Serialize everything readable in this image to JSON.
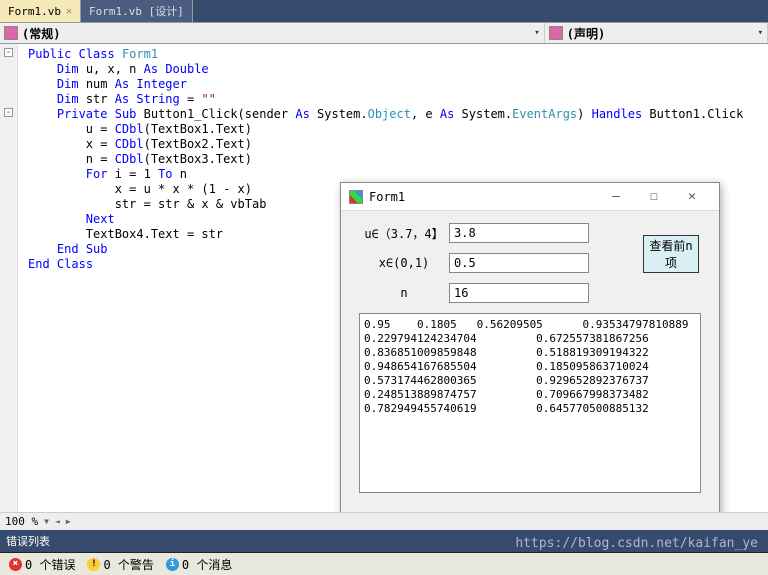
{
  "tabs": {
    "active": "Form1.vb",
    "inactive": "Form1.vb [设计]"
  },
  "dropdowns": {
    "left": "(常规)",
    "right": "(声明)"
  },
  "code": {
    "l1a": "Public",
    "l1b": "Class",
    "l1c": "Form1",
    "l2a": "Dim",
    "l2b": " u, x, n ",
    "l2c": "As",
    "l2d": "Double",
    "l3a": "Dim",
    "l3b": " num ",
    "l3c": "As",
    "l3d": "Integer",
    "l4a": "Dim",
    "l4b": " str ",
    "l4c": "As",
    "l4d": "String",
    "l4e": " = ",
    "l4f": "\"\"",
    "l5a": "Private",
    "l5b": "Sub",
    "l5c": " Button1_Click(sender ",
    "l5d": "As",
    "l5e": " System.",
    "l5f": "Object",
    "l5g": ", e ",
    "l5h": "As",
    "l5i": " System.",
    "l5j": "EventArgs",
    "l5k": ") ",
    "l5l": "Handles",
    "l5m": " Button1.Click",
    "l6": "u = ",
    "l6b": "CDbl",
    "l6c": "(TextBox1.Text)",
    "l7": "x = ",
    "l7b": "CDbl",
    "l7c": "(TextBox2.Text)",
    "l8": "n = ",
    "l8b": "CDbl",
    "l8c": "(TextBox3.Text)",
    "l9a": "For",
    "l9b": " i = 1 ",
    "l9c": "To",
    "l9d": " n",
    "l10": "x = u * x * (1 - x)",
    "l11": "str = str & x & vbTab",
    "l12": "Next",
    "l13": "TextBox4.Text = str",
    "l14a": "End",
    "l14b": "Sub",
    "l15a": "End",
    "l15b": "Class"
  },
  "form": {
    "title": "Form1",
    "labels": {
      "u": "u∈（3.7，4】",
      "x": "x∈(0,1)",
      "n": "n"
    },
    "values": {
      "u": "3.8",
      "x": "0.5",
      "n": "16"
    },
    "button": "查看前n项",
    "output": "0.95    0.1805   0.56209505      0.93534797810889\n0.229794124234704         0.672557381867256\n0.836851009859848         0.518819309194322\n0.948654167685504         0.185095863710024\n0.573174462800365         0.929652892376737\n0.248513889874757         0.709667998373482\n0.782949455740619         0.645770500885132"
  },
  "zoom": "100 %",
  "errors": {
    "header": "错误列表",
    "e0": "0 个错误",
    "w0": "0 个警告",
    "m0": "0 个消息"
  },
  "watermark": "https://blog.csdn.net/kaifan_ye"
}
